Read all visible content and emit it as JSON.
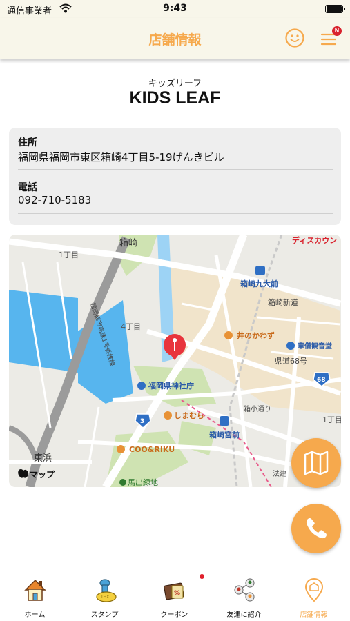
{
  "status_bar": {
    "carrier": "通信事業者",
    "time": "9:43"
  },
  "nav": {
    "title": "店舗情報",
    "menu_badge": "N"
  },
  "store": {
    "name_kana": "キッズリーフ",
    "name": "KIDS LEAF"
  },
  "info": {
    "address_label": "住所",
    "address": "福岡県福岡市東区箱崎4丁目5-19げんきビル",
    "phone_label": "電話",
    "phone": "092-710-5183"
  },
  "map": {
    "labels": {
      "hakozaki": "箱崎",
      "chome1_a": "1丁目",
      "chome1_b": "1丁目",
      "chome4": "4丁目",
      "disukaun": "ディスカウン",
      "kyudaimae": "箱崎九大前",
      "shindo": "箱崎新道",
      "inokawazu": "井のかわず",
      "kanshodo": "車僧観音堂",
      "kendo68": "県道68号",
      "route68": "68",
      "shrine_office": "福岡県神社庁",
      "shimamura": "しまむら",
      "route3": "3",
      "hakokodori": "箱小通り",
      "miyamae": "箱崎宮前",
      "coo": "COO&RIKU",
      "higashihama": "東浜",
      "apple_maps": "マップ",
      "law": "法建",
      "umade": "馬出緑地",
      "expressway": "福岡都市高速1号香椎線"
    }
  },
  "tabs": [
    {
      "label": "ホーム",
      "icon": "home-icon"
    },
    {
      "label": "スタンプ",
      "icon": "stamp-icon"
    },
    {
      "label": "クーポン",
      "icon": "coupon-icon"
    },
    {
      "label": "友達に紹介",
      "icon": "share-icon"
    },
    {
      "label": "店舗情報",
      "icon": "store-pin-icon"
    }
  ],
  "colors": {
    "accent": "#f6a94d",
    "header_bg": "#f8f6ea",
    "badge": "#d9232e"
  }
}
